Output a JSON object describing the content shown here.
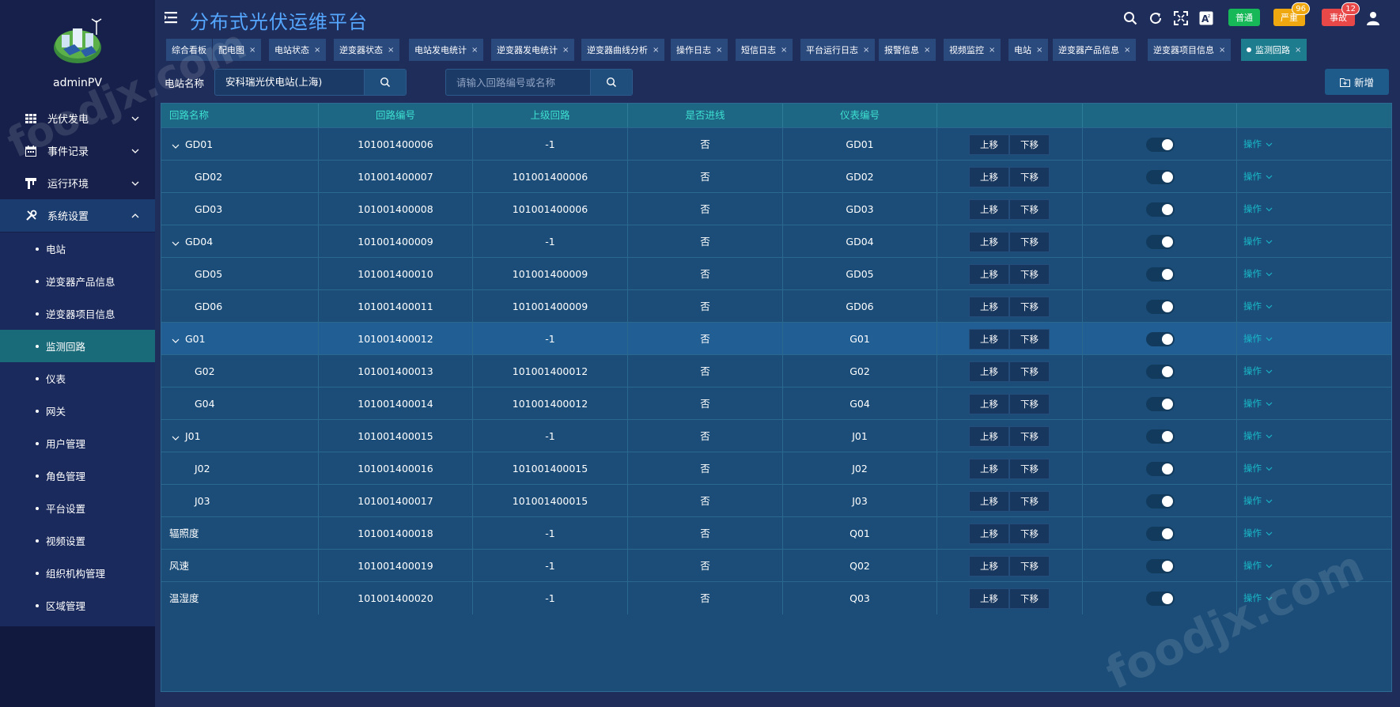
{
  "app": {
    "title": "分布式光伏运维平台",
    "user": "adminPV"
  },
  "header": {
    "pills": [
      {
        "label": "普通",
        "color": "#16b858",
        "badge": ""
      },
      {
        "label": "严重",
        "color": "#f0a810",
        "badge": "96"
      },
      {
        "label": "事故",
        "color": "#e84848",
        "badge": "12"
      }
    ],
    "icons": [
      "search-icon",
      "refresh-icon",
      "fullscreen-icon",
      "font-size-icon"
    ]
  },
  "sidebar": {
    "groups": [
      {
        "label": "光伏发电",
        "icon": "grid-icon"
      },
      {
        "label": "事件记录",
        "icon": "calendar-icon"
      },
      {
        "label": "运行环境",
        "icon": "tower-icon"
      },
      {
        "label": "系统设置",
        "icon": "tools-icon"
      }
    ],
    "subitems": [
      "电站",
      "逆变器产品信息",
      "逆变器项目信息",
      "监测回路",
      "仪表",
      "网关",
      "用户管理",
      "角色管理",
      "平台设置",
      "视频设置",
      "组织机构管理",
      "区域管理"
    ]
  },
  "tabs": [
    "综合看板",
    "配电图",
    "电站状态",
    "逆变器状态",
    "电站发电统计",
    "逆变器发电统计",
    "逆变器曲线分析",
    "操作日志",
    "短信日志",
    "平台运行日志",
    "报警信息",
    "视频监控",
    "电站",
    "逆变器产品信息",
    "逆变器项目信息",
    "监测回路"
  ],
  "filter": {
    "station_label": "电站名称",
    "station_value": "安科瑞光伏电站(上海)",
    "circuit_placeholder": "请输入回路编号或名称",
    "add_label": "新增"
  },
  "table": {
    "headers": [
      "回路名称",
      "回路编号",
      "上级回路",
      "是否进线",
      "仪表编号",
      "",
      "",
      ""
    ],
    "move_up": "上移",
    "move_down": "下移",
    "op_label": "操作",
    "rows": [
      {
        "name": "GD01",
        "code": "101001400006",
        "parent": "-1",
        "incoming": "否",
        "meter": "GD01",
        "level": 0,
        "expandable": true
      },
      {
        "name": "GD02",
        "code": "101001400007",
        "parent": "101001400006",
        "incoming": "否",
        "meter": "GD02",
        "level": 1,
        "expandable": false
      },
      {
        "name": "GD03",
        "code": "101001400008",
        "parent": "101001400006",
        "incoming": "否",
        "meter": "GD03",
        "level": 1,
        "expandable": false
      },
      {
        "name": "GD04",
        "code": "101001400009",
        "parent": "-1",
        "incoming": "否",
        "meter": "GD04",
        "level": 0,
        "expandable": true
      },
      {
        "name": "GD05",
        "code": "101001400010",
        "parent": "101001400009",
        "incoming": "否",
        "meter": "GD05",
        "level": 1,
        "expandable": false
      },
      {
        "name": "GD06",
        "code": "101001400011",
        "parent": "101001400009",
        "incoming": "否",
        "meter": "GD06",
        "level": 1,
        "expandable": false
      },
      {
        "name": "G01",
        "code": "101001400012",
        "parent": "-1",
        "incoming": "否",
        "meter": "G01",
        "level": 0,
        "expandable": true
      },
      {
        "name": "G02",
        "code": "101001400013",
        "parent": "101001400012",
        "incoming": "否",
        "meter": "G02",
        "level": 1,
        "expandable": false
      },
      {
        "name": "G04",
        "code": "101001400014",
        "parent": "101001400012",
        "incoming": "否",
        "meter": "G04",
        "level": 1,
        "expandable": false
      },
      {
        "name": "J01",
        "code": "101001400015",
        "parent": "-1",
        "incoming": "否",
        "meter": "J01",
        "level": 0,
        "expandable": true
      },
      {
        "name": "J02",
        "code": "101001400016",
        "parent": "101001400015",
        "incoming": "否",
        "meter": "J02",
        "level": 1,
        "expandable": false
      },
      {
        "name": "J03",
        "code": "101001400017",
        "parent": "101001400015",
        "incoming": "否",
        "meter": "J03",
        "level": 1,
        "expandable": false
      },
      {
        "name": "辐照度",
        "code": "101001400018",
        "parent": "-1",
        "incoming": "否",
        "meter": "Q01",
        "level": 0,
        "expandable": false
      },
      {
        "name": "风速",
        "code": "101001400019",
        "parent": "-1",
        "incoming": "否",
        "meter": "Q02",
        "level": 0,
        "expandable": false
      },
      {
        "name": "温湿度",
        "code": "101001400020",
        "parent": "-1",
        "incoming": "否",
        "meter": "Q03",
        "level": 0,
        "expandable": false
      }
    ]
  },
  "watermark": "foodjx.com"
}
